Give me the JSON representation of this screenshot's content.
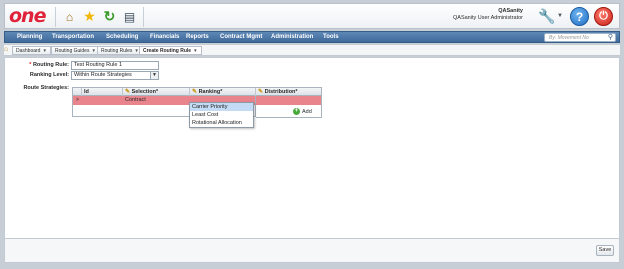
{
  "header": {
    "logo_text": "one",
    "user_name": "QASanity",
    "user_role": "QASanity User Administrator",
    "icons": [
      "home-icon",
      "star-icon",
      "refresh-icon",
      "presentation-icon",
      "wrench-icon",
      "help-icon",
      "power-icon"
    ]
  },
  "menu": {
    "items": [
      "Planning",
      "Transportation",
      "Scheduling",
      "Financials",
      "Reports",
      "Contract Mgmt",
      "Administration",
      "Tools"
    ],
    "search_placeholder": "By: Movement No"
  },
  "tabs": [
    {
      "label": "Dashboard"
    },
    {
      "label": "Routing Guides"
    },
    {
      "label": "Routing Rules"
    },
    {
      "label": "Create Routing Rule"
    }
  ],
  "form": {
    "routing_rule_label": "Routing Rule:",
    "routing_rule_value": "Test Routing Rule 1",
    "ranking_level_label": "Ranking Level:",
    "ranking_level_value": "Within Route Strategies",
    "route_strategies_label": "Route Strategies:"
  },
  "grid": {
    "columns": [
      "Id",
      "Selection*",
      "Ranking*",
      "Distribution*"
    ],
    "rows": [
      {
        "marker": ">",
        "id": "",
        "selection": "Contract",
        "ranking": "",
        "distribution": ""
      }
    ],
    "add_label": "Add"
  },
  "ranking_options": [
    "Carrier Priority",
    "Least Cost",
    "Rotational Allocation"
  ],
  "footer": {
    "save_label": "Save"
  },
  "colors": {
    "menu_bar": "#4a76a8",
    "selected_row": "#e9838c",
    "dropdown_highlight": "#c3dbf4",
    "logo": "#e0223a"
  }
}
